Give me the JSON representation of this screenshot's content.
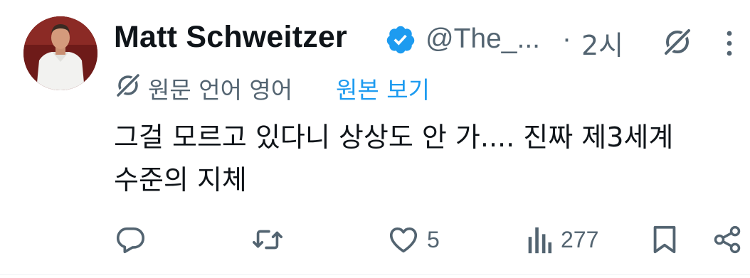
{
  "tweet": {
    "author_name": "Matt Schweitzer",
    "handle": "@The_...",
    "separator": "·",
    "time": "2시",
    "translation": {
      "label": "원문 언어 영어",
      "show_original": "원본 보기"
    },
    "text_lines": [
      "그걸 모르고 있다니 상상도 안 가....  진짜 제3세계",
      "수준의 지체"
    ],
    "stats": {
      "likes": "5",
      "views": "277"
    }
  },
  "colors": {
    "text": "#0f1419",
    "secondary": "#536471",
    "link": "#1d9bf0",
    "verified": "#1d9bf0"
  },
  "icons": {
    "verified": "verified-badge-icon",
    "grok": "grok-icon",
    "more": "more-vertical-icon",
    "translate": "grok-icon",
    "reply": "reply-icon",
    "retweet": "retweet-icon",
    "like": "heart-icon",
    "views": "views-icon",
    "bookmark": "bookmark-icon",
    "share": "share-icon"
  }
}
